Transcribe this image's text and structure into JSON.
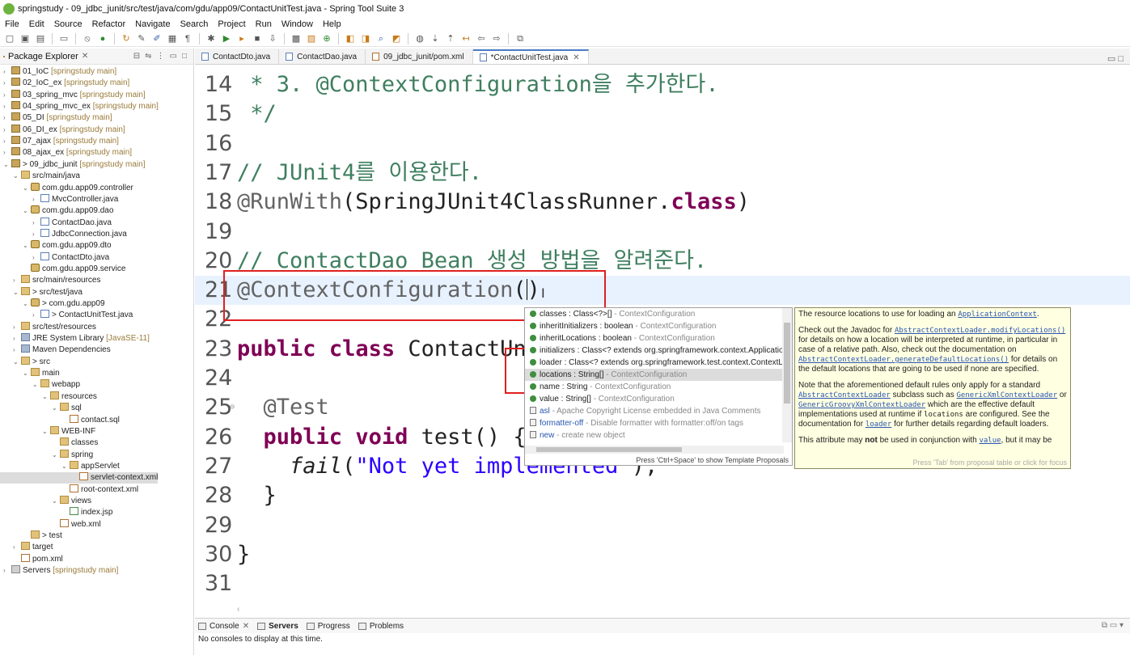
{
  "window": {
    "title": "springstudy - 09_jdbc_junit/src/test/java/com/gdu/app09/ContactUnitTest.java - Spring Tool Suite 3"
  },
  "menu": [
    "File",
    "Edit",
    "Source",
    "Refactor",
    "Navigate",
    "Search",
    "Project",
    "Run",
    "Window",
    "Help"
  ],
  "explorer": {
    "title": "Package Explorer",
    "items": [
      {
        "label": "01_IoC",
        "decor": " [springstudy main]",
        "kind": "proj",
        "depth": 0,
        "tw": ">"
      },
      {
        "label": "02_IoC_ex",
        "decor": " [springstudy main]",
        "kind": "proj",
        "depth": 0,
        "tw": ">"
      },
      {
        "label": "03_spring_mvc",
        "decor": " [springstudy main]",
        "kind": "proj",
        "depth": 0,
        "tw": ">"
      },
      {
        "label": "04_spring_mvc_ex",
        "decor": " [springstudy main]",
        "kind": "proj",
        "depth": 0,
        "tw": ">"
      },
      {
        "label": "05_DI",
        "decor": " [springstudy main]",
        "kind": "proj",
        "depth": 0,
        "tw": ">"
      },
      {
        "label": "06_DI_ex",
        "decor": " [springstudy main]",
        "kind": "proj",
        "depth": 0,
        "tw": ">"
      },
      {
        "label": "07_ajax",
        "decor": " [springstudy main]",
        "kind": "proj",
        "depth": 0,
        "tw": ">"
      },
      {
        "label": "08_ajax_ex",
        "decor": " [springstudy main]",
        "kind": "proj",
        "depth": 0,
        "tw": ">"
      },
      {
        "label": "> 09_jdbc_junit",
        "decor": " [springstudy main]",
        "kind": "proj",
        "depth": 0,
        "tw": "v"
      },
      {
        "label": "src/main/java",
        "decor": "",
        "kind": "fold",
        "depth": 1,
        "tw": "v"
      },
      {
        "label": "com.gdu.app09.controller",
        "decor": "",
        "kind": "pkg",
        "depth": 2,
        "tw": "v"
      },
      {
        "label": "MvcController.java",
        "decor": "",
        "kind": "java",
        "depth": 3,
        "tw": ">"
      },
      {
        "label": "com.gdu.app09.dao",
        "decor": "",
        "kind": "pkg",
        "depth": 2,
        "tw": "v"
      },
      {
        "label": "ContactDao.java",
        "decor": "",
        "kind": "java",
        "depth": 3,
        "tw": ">"
      },
      {
        "label": "JdbcConnection.java",
        "decor": "",
        "kind": "java",
        "depth": 3,
        "tw": ">"
      },
      {
        "label": "com.gdu.app09.dto",
        "decor": "",
        "kind": "pkg",
        "depth": 2,
        "tw": "v"
      },
      {
        "label": "ContactDto.java",
        "decor": "",
        "kind": "java",
        "depth": 3,
        "tw": ">"
      },
      {
        "label": "com.gdu.app09.service",
        "decor": "",
        "kind": "pkg",
        "depth": 2,
        "tw": ""
      },
      {
        "label": "src/main/resources",
        "decor": "",
        "kind": "fold",
        "depth": 1,
        "tw": ">"
      },
      {
        "label": "> src/test/java",
        "decor": "",
        "kind": "fold",
        "depth": 1,
        "tw": "v"
      },
      {
        "label": "> com.gdu.app09",
        "decor": "",
        "kind": "pkg",
        "depth": 2,
        "tw": "v"
      },
      {
        "label": "> ContactUnitTest.java",
        "decor": "",
        "kind": "java",
        "depth": 3,
        "tw": ">"
      },
      {
        "label": "src/test/resources",
        "decor": "",
        "kind": "fold",
        "depth": 1,
        "tw": ">"
      },
      {
        "label": "JRE System Library",
        "decor": " [JavaSE-11]",
        "kind": "lib",
        "depth": 1,
        "tw": ">"
      },
      {
        "label": "Maven Dependencies",
        "decor": "",
        "kind": "lib",
        "depth": 1,
        "tw": ">"
      },
      {
        "label": "> src",
        "decor": "",
        "kind": "fold",
        "depth": 1,
        "tw": "v"
      },
      {
        "label": "main",
        "decor": "",
        "kind": "fold",
        "depth": 2,
        "tw": "v"
      },
      {
        "label": "webapp",
        "decor": "",
        "kind": "fold",
        "depth": 3,
        "tw": "v"
      },
      {
        "label": "resources",
        "decor": "",
        "kind": "fold",
        "depth": 4,
        "tw": "v"
      },
      {
        "label": "sql",
        "decor": "",
        "kind": "fold",
        "depth": 5,
        "tw": "v"
      },
      {
        "label": "contact.sql",
        "decor": "",
        "kind": "xml",
        "depth": 6,
        "tw": ""
      },
      {
        "label": "WEB-INF",
        "decor": "",
        "kind": "fold",
        "depth": 4,
        "tw": "v"
      },
      {
        "label": "classes",
        "decor": "",
        "kind": "fold",
        "depth": 5,
        "tw": ""
      },
      {
        "label": "spring",
        "decor": "",
        "kind": "fold",
        "depth": 5,
        "tw": "v"
      },
      {
        "label": "appServlet",
        "decor": "",
        "kind": "fold",
        "depth": 6,
        "tw": "v"
      },
      {
        "label": "servlet-context.xml",
        "decor": "",
        "kind": "xml",
        "depth": 7,
        "tw": "",
        "selected": true
      },
      {
        "label": "root-context.xml",
        "decor": "",
        "kind": "xml",
        "depth": 6,
        "tw": ""
      },
      {
        "label": "views",
        "decor": "",
        "kind": "fold",
        "depth": 5,
        "tw": "v"
      },
      {
        "label": "index.jsp",
        "decor": "",
        "kind": "jsp",
        "depth": 6,
        "tw": ""
      },
      {
        "label": "web.xml",
        "decor": "",
        "kind": "xml",
        "depth": 5,
        "tw": ""
      },
      {
        "label": "> test",
        "decor": "",
        "kind": "fold",
        "depth": 2,
        "tw": ""
      },
      {
        "label": "target",
        "decor": "",
        "kind": "fold",
        "depth": 1,
        "tw": ">"
      },
      {
        "label": "pom.xml",
        "decor": "",
        "kind": "xml",
        "depth": 1,
        "tw": ""
      },
      {
        "label": "Servers",
        "decor": " [springstudy main]",
        "kind": "srv",
        "depth": 0,
        "tw": ">"
      }
    ]
  },
  "editor_tabs": [
    {
      "label": "ContactDto.java",
      "kind": "java",
      "active": false
    },
    {
      "label": "ContactDao.java",
      "kind": "java",
      "active": false
    },
    {
      "label": "09_jdbc_junit/pom.xml",
      "kind": "xml",
      "active": false
    },
    {
      "label": "*ContactUnitTest.java",
      "kind": "java",
      "active": true
    }
  ],
  "code_lines": [
    {
      "n": "14",
      "html_parts": [
        {
          "t": " * 3. @ContextConfiguration을 추가한다.",
          "c": "cm"
        }
      ]
    },
    {
      "n": "15",
      "html_parts": [
        {
          "t": " */",
          "c": "cm"
        }
      ]
    },
    {
      "n": "16",
      "html_parts": []
    },
    {
      "n": "17",
      "html_parts": [
        {
          "t": "// JUnit4를 이용한다.",
          "c": "cm"
        }
      ]
    },
    {
      "n": "18",
      "html_parts": [
        {
          "t": "@RunWith",
          "c": "an"
        },
        {
          "t": "(SpringJUnit4ClassRunner.",
          "c": ""
        },
        {
          "t": "class",
          "c": "kw"
        },
        {
          "t": ")",
          "c": ""
        }
      ]
    },
    {
      "n": "19",
      "html_parts": []
    },
    {
      "n": "20",
      "html_parts": [
        {
          "t": "// ContactDao Bean 생성 방법을 알려준다.",
          "c": "cm"
        }
      ]
    },
    {
      "n": "21",
      "html_parts": [
        {
          "t": "@ContextConfiguration",
          "c": "an"
        },
        {
          "t": "()",
          "c": ""
        }
      ],
      "current": true
    },
    {
      "n": "22",
      "html_parts": []
    },
    {
      "n": "23",
      "html_parts": [
        {
          "t": "public",
          "c": "kw"
        },
        {
          "t": " ",
          "c": ""
        },
        {
          "t": "class",
          "c": "kw"
        },
        {
          "t": " ContactUn",
          "c": ""
        }
      ]
    },
    {
      "n": "24",
      "html_parts": []
    },
    {
      "n": "25",
      "html_parts": [
        {
          "t": "  @Test",
          "c": "an"
        }
      ],
      "fold": true
    },
    {
      "n": "26",
      "html_parts": [
        {
          "t": "  ",
          "c": ""
        },
        {
          "t": "public",
          "c": "kw"
        },
        {
          "t": " ",
          "c": ""
        },
        {
          "t": "void",
          "c": "kw"
        },
        {
          "t": " test() {",
          "c": ""
        }
      ]
    },
    {
      "n": "27",
      "html_parts": [
        {
          "t": "    ",
          "c": ""
        },
        {
          "t": "fail",
          "c": "it"
        },
        {
          "t": "(",
          "c": ""
        },
        {
          "t": "\"Not yet implemented",
          "c": "st"
        },
        {
          "t": "\");",
          "c": ""
        }
      ]
    },
    {
      "n": "28",
      "html_parts": [
        {
          "t": "  }",
          "c": ""
        }
      ]
    },
    {
      "n": "29",
      "html_parts": []
    },
    {
      "n": "30",
      "html_parts": [
        {
          "t": "}",
          "c": ""
        }
      ]
    },
    {
      "n": "31",
      "html_parts": []
    }
  ],
  "content_assist": {
    "items": [
      {
        "name": "classes : Class<?>[]",
        "src": " - ContextConfiguration",
        "icon": "bullet"
      },
      {
        "name": "inheritInitializers : boolean",
        "src": " - ContextConfiguration",
        "icon": "bullet"
      },
      {
        "name": "inheritLocations : boolean",
        "src": " - ContextConfiguration",
        "icon": "bullet"
      },
      {
        "name": "initializers : Class<? extends org.springframework.context.Applicatio",
        "src": "",
        "icon": "bullet"
      },
      {
        "name": "loader : Class<? extends org.springframework.test.context.ContextLoa",
        "src": "",
        "icon": "bullet"
      },
      {
        "name": "locations : String[]",
        "src": " - ContextConfiguration",
        "icon": "bullet",
        "selected": true
      },
      {
        "name": "name : String",
        "src": " - ContextConfiguration",
        "icon": "bullet"
      },
      {
        "name": "value : String[]",
        "src": " - ContextConfiguration",
        "icon": "bullet"
      },
      {
        "name": "asl",
        "src": " - Apache Copyright License embedded in Java Comments",
        "icon": "tp",
        "link": true
      },
      {
        "name": "formatter-off",
        "src": " - Disable formatter with formatter:off/on tags",
        "icon": "tp",
        "link": true
      },
      {
        "name": "new",
        "src": " - create new object",
        "icon": "tp",
        "link": true
      }
    ],
    "footer": "Press 'Ctrl+Space' to show Template Proposals"
  },
  "javadoc": {
    "p1_text": "The resource locations to use for loading an ",
    "p1_link": "ApplicationContext",
    "p1_end": ".",
    "p2_a": "Check out the Javadoc for ",
    "p2_link1": "AbstractContextLoader.modifyLocations()",
    "p2_b": " for details on how a location will be interpreted at runtime, in particular in case of a relative path. Also, check out the documentation on ",
    "p2_link2": "AbstractContextLoader.generateDefaultLocations()",
    "p2_c": " for details on the default locations that are going to be used if none are specified.",
    "p3_a": "Note that the aforementioned default rules only apply for a standard ",
    "p3_link1": "AbstractContextLoader",
    "p3_b": " subclass such as ",
    "p3_link2": "GenericXmlContextLoader",
    "p3_c": " or ",
    "p3_link3": "GenericGroovyXmlContextLoader",
    "p3_d": " which are the effective default implementations used at runtime if ",
    "p3_mono": "locations",
    "p3_e": " are configured. See the documentation for ",
    "p3_link4": "loader",
    "p3_f": " for further details regarding default loaders.",
    "p4_a": "This attribute may ",
    "p4_bold": "not",
    "p4_b": " be used in conjunction with ",
    "p4_link": "value",
    "p4_c": ", but it may be",
    "footer": "Press 'Tab' from proposal table or click for focus"
  },
  "console": {
    "tabs": [
      "Console",
      "Servers",
      "Progress",
      "Problems"
    ],
    "body": "No consoles to display at this time."
  },
  "colors": {
    "keyword": "#7f0055",
    "comment": "#3f7f5f",
    "annotation": "#646464",
    "string": "#2a00ff",
    "highlight_box": "#e02020"
  }
}
